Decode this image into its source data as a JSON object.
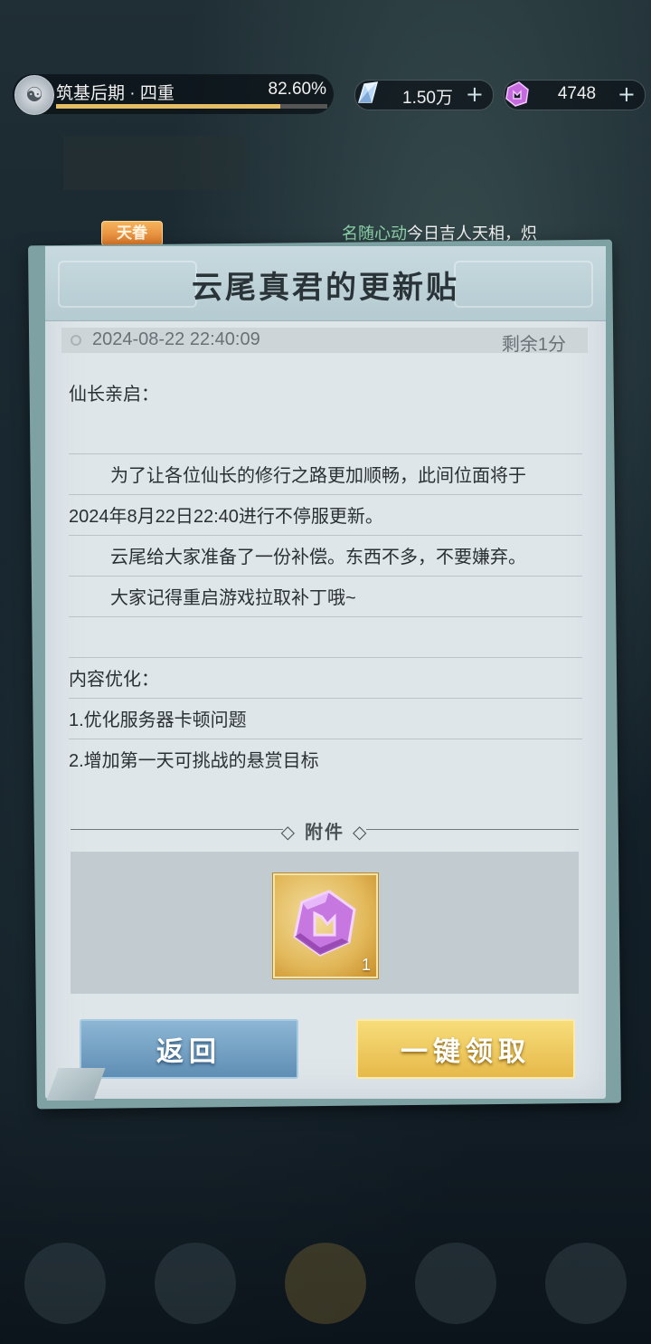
{
  "status": {
    "realm_name": "筑基后期 · 四重",
    "realm_progress_text": "82.60%",
    "realm_progress": 0.826,
    "currency1_value": "1.50万",
    "currency1_icon": "blue-crystal-icon",
    "currency2_value": "4748",
    "currency2_icon": "purple-jade-icon",
    "plus": "+"
  },
  "announcement": {
    "tag": "天眷",
    "text_highlight": "名随心动",
    "text_rest": "今日吉人天相，炽"
  },
  "mail": {
    "title": "云尾真君的更新贴",
    "date": "2024-08-22 22:40:09",
    "time_left": "剩余1分",
    "lines": [
      "仙长亲启：",
      "",
      "为了让各位仙长的修行之路更加顺畅，此间位面将于",
      "2024年8月22日22:40进行不停服更新。",
      "云尾给大家准备了一份补偿。东西不多，不要嫌弃。",
      "大家记得重启游戏拉取补丁哦~",
      "",
      "内容优化：",
      "1.优化服务器卡顿问题",
      "2.增加第一天可挑战的悬赏目标"
    ],
    "attachment_label": "附件",
    "attachment_item": {
      "icon": "purple-jade-icon",
      "count": "1"
    }
  },
  "buttons": {
    "back": "返回",
    "claim_all": "一键领取"
  },
  "colors": {
    "claim_button": "#e6b94a",
    "back_button": "#5f8eb4",
    "progress_fill": "#e4be64",
    "highlight_text": "#8cd2a8"
  }
}
